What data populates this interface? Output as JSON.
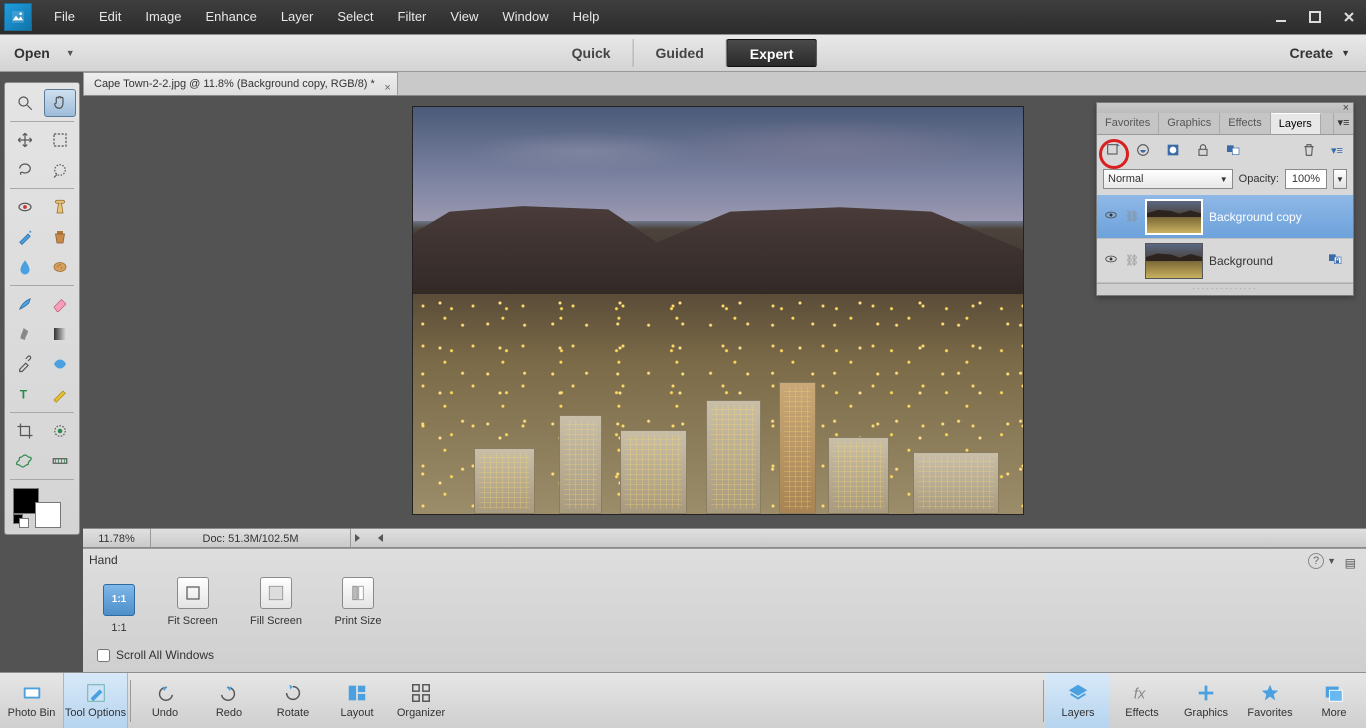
{
  "menubar": {
    "items": [
      "File",
      "Edit",
      "Image",
      "Enhance",
      "Layer",
      "Select",
      "Filter",
      "View",
      "Window",
      "Help"
    ]
  },
  "modebar": {
    "open": "Open",
    "modes": [
      "Quick",
      "Guided",
      "Expert"
    ],
    "active_mode": "Expert",
    "create": "Create"
  },
  "doc_tab": {
    "title": "Cape Town-2-2.jpg @ 11.8% (Background copy, RGB/8) *"
  },
  "infobar": {
    "zoom": "11.78%",
    "docsize": "Doc: 51.3M/102.5M"
  },
  "tool_options": {
    "current_tool": "Hand",
    "buttons": [
      {
        "key": "1:1",
        "label": "1:1",
        "active": true
      },
      {
        "key": "fit",
        "label": "Fit Screen",
        "active": false
      },
      {
        "key": "fill",
        "label": "Fill Screen",
        "active": false
      },
      {
        "key": "print",
        "label": "Print Size",
        "active": false
      }
    ],
    "scroll_all": "Scroll All Windows"
  },
  "cmdbar": {
    "left": [
      {
        "key": "photobin",
        "label": "Photo Bin"
      },
      {
        "key": "toolopts",
        "label": "Tool Options",
        "active": true
      }
    ],
    "mid": [
      {
        "key": "undo",
        "label": "Undo"
      },
      {
        "key": "redo",
        "label": "Redo"
      },
      {
        "key": "rotate",
        "label": "Rotate"
      },
      {
        "key": "layout",
        "label": "Layout"
      },
      {
        "key": "organizer",
        "label": "Organizer"
      }
    ],
    "right": [
      {
        "key": "layers",
        "label": "Layers",
        "active": true
      },
      {
        "key": "effects",
        "label": "Effects"
      },
      {
        "key": "graphics",
        "label": "Graphics"
      },
      {
        "key": "favorites",
        "label": "Favorites"
      },
      {
        "key": "more",
        "label": "More"
      }
    ]
  },
  "layers_panel": {
    "tabs": [
      "Favorites",
      "Graphics",
      "Effects",
      "Layers"
    ],
    "active_tab": "Layers",
    "blend_mode": "Normal",
    "opacity_label": "Opacity:",
    "opacity_value": "100%",
    "layers": [
      {
        "name": "Background copy",
        "selected": true,
        "locked": false
      },
      {
        "name": "Background",
        "selected": false,
        "locked": true
      }
    ]
  },
  "toolbox_tools": [
    [
      "zoom",
      "hand"
    ],
    [
      "move",
      "rect-marquee"
    ],
    [
      "lasso",
      "quick-select"
    ],
    [
      "redeye",
      "healing"
    ],
    [
      "smart-brush",
      "stamp"
    ],
    [
      "blur",
      "sponge"
    ],
    [
      "brush",
      "eraser"
    ],
    [
      "smudge",
      "gradient"
    ],
    [
      "eyedrop",
      "shape"
    ],
    [
      "type",
      "pencil"
    ],
    [
      "crop",
      "cookie"
    ],
    [
      "flower",
      "options"
    ]
  ],
  "colors": {
    "fg": "#000000",
    "bg": "#ffffff"
  }
}
